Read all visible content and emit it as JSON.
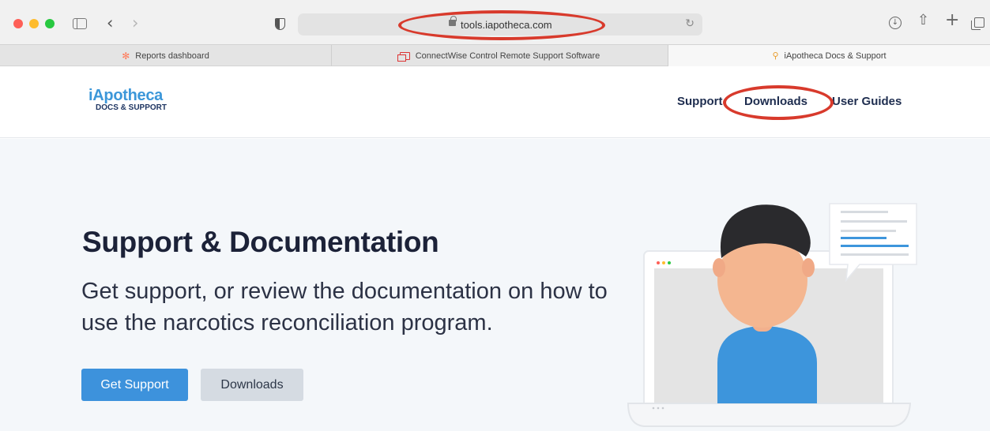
{
  "browser": {
    "url": "tools.iapotheca.com",
    "icons": {
      "back": "chevron-left-icon",
      "forward": "chevron-right-icon",
      "reload": "reload-icon",
      "share": "share-icon",
      "new_tab": "plus-icon",
      "tabs": "tab-overview-icon",
      "download": "download-icon"
    },
    "tabs": [
      {
        "label": "Reports dashboard",
        "favicon": "hubspot-icon"
      },
      {
        "label": "ConnectWise Control Remote Support Software",
        "favicon": "connectwise-icon"
      },
      {
        "label": "iApotheca Docs & Support",
        "favicon": "iapotheca-icon",
        "active": true
      }
    ]
  },
  "header": {
    "logo_main": "iApotheca",
    "logo_sub": "DOCS & SUPPORT",
    "nav": {
      "support": "Support",
      "downloads": "Downloads",
      "user_guides": "User Guides"
    }
  },
  "hero": {
    "title": "Support & Documentation",
    "description": "Get support, or review the documentation on how to use the narcotics reconciliation program.",
    "primary_button": "Get Support",
    "secondary_button": "Downloads"
  },
  "colors": {
    "annotation": "#d83a2c",
    "brand_blue": "#3c97d9",
    "navy": "#1e2d4f",
    "hero_bg": "#f4f7fa"
  }
}
